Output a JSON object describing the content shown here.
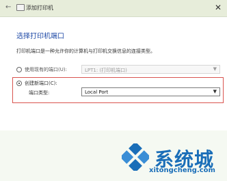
{
  "window": {
    "title": "添加打印机",
    "close_glyph": "✕"
  },
  "content": {
    "heading": "选择打印机端口",
    "description": "打印机端口是一种允许你的计算机与打印机交换信息的连接类型。",
    "existing_port": {
      "label": "使用现有的端口(U):",
      "value": "LPT1: (打印机端口)"
    },
    "new_port": {
      "label": "创建新端口(C):",
      "type_label": "端口类型:",
      "value": "Local Port"
    }
  },
  "watermark": {
    "text": "系统城",
    "url": "xitongcheng.com"
  },
  "colors": {
    "heading": "#1f4aa6",
    "highlight_border": "#d9534f",
    "watermark": "#1a6eb8"
  }
}
